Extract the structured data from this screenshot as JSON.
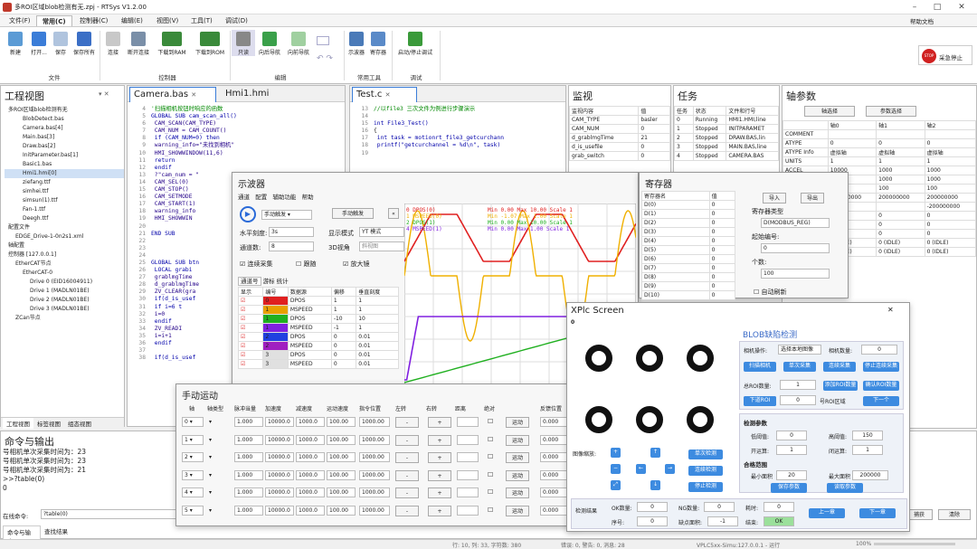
{
  "window": {
    "title": "多ROI区域blob检测有无.zpj - RTSys V1.2.00",
    "help_label": "帮助文档"
  },
  "menus": [
    "文件(F)",
    "常用(C)",
    "控制器(C)",
    "编辑(E)",
    "视图(V)",
    "工具(T)",
    "调试(D)"
  ],
  "ribbon": {
    "file": [
      "新建",
      "打开...",
      "保存",
      "保存所有"
    ],
    "controller": [
      "连接",
      "断开连接",
      "下载到RAM",
      "下载到ROM"
    ],
    "edit": [
      "只读",
      "向后导航",
      "向前导航"
    ],
    "tools": [
      "示波器",
      "寄存器"
    ],
    "debug": [
      "启动/停止调试"
    ],
    "groups": {
      "file": "文件",
      "controller": "控制器",
      "edit": "编辑",
      "tools": "常用工具",
      "debug": "调试"
    },
    "estop": "采急停止"
  },
  "project": {
    "title": "工程视图",
    "items": [
      "多ROI区域blob检测有无",
      "BlobDetect.bas",
      "Camera.bas[4]",
      "Main.bas[3]",
      "Draw.bas[2]",
      "InitParameter.bas[1]",
      "Basic1.bas",
      "Hmi1.hmi[0]",
      "ziefang.ttf",
      "simhei.ttf",
      "simsun(1).ttf",
      "Fan-1.ttf",
      "Deegh.ttf",
      "配置文件",
      "EDGE_Drive-1-0n2s1.xml",
      "轴配置",
      "控制器 [127.0.0.1]",
      "EtherCAT节点",
      "EtherCAT-0",
      "Drive 0 (EID16004911)",
      "Drive 1 (MADLN01BE)",
      "Drive 2 (MADLN01BE)",
      "Drive 3 (MADLN01BE)",
      "ZCan节点"
    ],
    "tabs": [
      "工程视图",
      "标签视图",
      "组态视图"
    ]
  },
  "editor_tabs": [
    "Camera.bas",
    "Hmi1.hmi",
    "Test.c"
  ],
  "camera_code": [
    [
      "4",
      "'扫描相机按钮时响应的函数"
    ],
    [
      "5",
      "GLOBAL SUB cam_scan_all()"
    ],
    [
      "6",
      "    CAM_SCAN(CAM_TYPE)"
    ],
    [
      "7",
      "    CAM_NUM = CAM_COUNT()"
    ],
    [
      "8",
      "    if (CAM_NUM=0) then"
    ],
    [
      "9",
      "        warning_info=\"未找到相机\""
    ],
    [
      "10",
      "        HMI_SHOWWINDOW(11,6)"
    ],
    [
      "11",
      "        return"
    ],
    [
      "12",
      "    endif"
    ],
    [
      "13",
      "    ?\"cam_num = \""
    ],
    [
      "14",
      "    CAM_SEL(0)"
    ],
    [
      "15",
      "    CAM_STOP()"
    ],
    [
      "16",
      "    CAM_SETMODE"
    ],
    [
      "17",
      "    CAM_START(1)"
    ],
    [
      "18",
      "    warning_info"
    ],
    [
      "19",
      "    HMI_SHOWWIN"
    ],
    [
      "20",
      ""
    ],
    [
      "21",
      "END SUB"
    ],
    [
      "22",
      ""
    ],
    [
      "23",
      ""
    ],
    [
      "24",
      ""
    ],
    [
      "25",
      "GLOBAL SUB btn"
    ],
    [
      "26",
      "    LOCAL grabi"
    ],
    [
      "27",
      "    grablmgTime"
    ],
    [
      "28",
      "    d_grablmgTime"
    ],
    [
      "29",
      "    ZV_CLEAR(gra"
    ],
    [
      "30",
      "    if(d_is_usef"
    ],
    [
      "31",
      "        if i=6 t"
    ],
    [
      "32",
      "            i=0"
    ],
    [
      "33",
      "        endif"
    ],
    [
      "34",
      "        ZV_READI"
    ],
    [
      "35",
      "        i=i+1"
    ],
    [
      "36",
      "    endif"
    ],
    [
      "37",
      ""
    ],
    [
      "38",
      "    if(d_is_usef"
    ]
  ],
  "test_code": [
    [
      "13",
      "//以file3 三次文件为例进行步骤演示"
    ],
    [
      "14",
      ""
    ],
    [
      "15",
      "int File3_Test()"
    ],
    [
      "16",
      "{"
    ],
    [
      "17",
      "    int task = motionrt_file3_getcurchann"
    ],
    [
      "18",
      "    printf(\"getcurchannel = %d\\n\", task)"
    ],
    [
      "19",
      ""
    ]
  ],
  "monitor": {
    "title": "监视",
    "cols": [
      "监视内容",
      "值"
    ],
    "rows": [
      [
        "CAM_TYPE",
        "basler"
      ],
      [
        "CAM_NUM",
        "0"
      ],
      [
        "d_grablmgTime",
        "21"
      ],
      [
        "d_is_usefile",
        "0"
      ],
      [
        "grab_switch",
        "0"
      ]
    ]
  },
  "task": {
    "title": "任务",
    "cols": [
      "任务",
      "状态",
      "文件和行号"
    ],
    "rows": [
      [
        "0",
        "Running",
        "HMI1.HMI,line"
      ],
      [
        "1",
        "Stopped",
        "INITPARAMET"
      ],
      [
        "2",
        "Stopped",
        "DRAW.BAS,lin"
      ],
      [
        "3",
        "Stopped",
        "MAIN.BAS,line"
      ],
      [
        "4",
        "Stopped",
        "CAMERA.BAS"
      ]
    ]
  },
  "axis": {
    "title": "轴参数",
    "btn1": "轴选择",
    "btn2": "参数选择",
    "cols": [
      "",
      "轴0",
      "轴1",
      "轴2"
    ],
    "rows": [
      [
        "COMMENT",
        "",
        "",
        ""
      ],
      [
        "ATYPE",
        "0",
        "0",
        "0"
      ],
      [
        "ATYPE Info",
        "虚拟轴",
        "虚拟轴",
        "虚拟轴"
      ],
      [
        "UNITS",
        "1",
        "1",
        "1"
      ],
      [
        "ACCEL",
        "10000",
        "1000",
        "1000"
      ],
      [
        "DECEL",
        "1000",
        "1000",
        "1000"
      ],
      [
        "SPEED",
        "100",
        "100",
        "100"
      ],
      [
        "",
        "200000000",
        "200000000",
        "200000000"
      ],
      [
        "",
        "",
        "",
        "-200000000"
      ],
      [
        "",
        "0",
        "0",
        "0"
      ],
      [
        "",
        "0",
        "0",
        "0"
      ],
      [
        "",
        "0",
        "0",
        "0"
      ],
      [
        "",
        "0 (IDLE)",
        "0 (IDLE)",
        "0 (IDLE)"
      ],
      [
        "",
        "0 (IDLE)",
        "0 (IDLE)",
        "0 (IDLE)"
      ]
    ]
  },
  "scope": {
    "title": "示波器",
    "menu": [
      "通道",
      "配置",
      "辅助功能",
      "帮助"
    ],
    "trigger": "手动触发",
    "trigger_btn": "手动触发",
    "hscale_label": "水平刻度:",
    "hscale": "3s",
    "mode_label": "显示模式",
    "mode": "YT 模式",
    "chcount_label": "通道数:",
    "chcount": "8",
    "view3d_label": "3D视角",
    "view3d": "斜视图",
    "continuous": "连续采集",
    "follow": "跟随",
    "zoom": "放大镜",
    "subtabs": [
      "通道号",
      "游标",
      "统计"
    ],
    "cols": [
      "显示",
      "编号",
      "数据源",
      "偏移",
      "垂直刻度"
    ],
    "rows": [
      [
        "0",
        "DPOS",
        "1",
        "1"
      ],
      [
        "1",
        "MSPEED",
        "1",
        "1"
      ],
      [
        "1",
        "DPOS",
        "-10",
        "10"
      ],
      [
        "1",
        "MSPEED",
        "-1",
        "1"
      ],
      [
        "2",
        "DPOS",
        "0",
        "0.01"
      ],
      [
        "2",
        "MSPEED",
        "0",
        "0.01"
      ],
      [
        "3",
        "DPOS",
        "0",
        "0.01"
      ],
      [
        "3",
        "MSPEED",
        "0",
        "0.01"
      ]
    ],
    "row_colors": [
      "#e02020",
      "#e8a000",
      "#20b020",
      "#8020e0",
      "#2040e0",
      "#a020c0",
      "#e0e0e0",
      "#e0e0e0"
    ],
    "legend": [
      "0 DPOS(0)",
      "1 MSPEED(0)",
      "2 DPOS(1)",
      "4 MSPEED(1)"
    ],
    "stats": [
      "Min 0.00  Max 10.00  Scale 1",
      "Min -1.07  Max 1.00  Scale 1",
      "Min 0.00  Max 10.00  Scale 1",
      "Min 0.00  Max 1.00  Scale 1"
    ]
  },
  "register": {
    "title": "寄存器",
    "cols": [
      "寄存器名",
      "值"
    ],
    "rows": [
      [
        "D(0)",
        "0"
      ],
      [
        "D(1)",
        "0"
      ],
      [
        "D(2)",
        "0"
      ],
      [
        "D(3)",
        "0"
      ],
      [
        "D(4)",
        "0"
      ],
      [
        "D(5)",
        "0"
      ],
      [
        "D(6)",
        "0"
      ],
      [
        "D(7)",
        "0"
      ],
      [
        "D(8)",
        "0"
      ],
      [
        "D(9)",
        "0"
      ],
      [
        "D(10)",
        "0"
      ]
    ],
    "import": "导入",
    "export": "导出",
    "type_label": "寄存器类型",
    "type": "D(MODBUS_REG)",
    "start_label": "起始编号:",
    "start": "0",
    "count_label": "个数:",
    "count": "100",
    "auto": "自动刷新"
  },
  "motion": {
    "title": "手动运动",
    "cols": [
      "轴",
      "轴类型",
      "脉冲当量",
      "加速度",
      "减速度",
      "运动速度",
      "指令位置",
      "左转",
      "右转",
      "距离",
      "绝对",
      "",
      "反馈位置"
    ],
    "rows": [
      [
        "0",
        "1.000",
        "10000.0",
        "1000.0",
        "100.00",
        "1000.00",
        "0.000"
      ],
      [
        "1",
        "1.000",
        "10000.0",
        "1000.0",
        "100.00",
        "1000.00",
        "0.000"
      ],
      [
        "2",
        "1.000",
        "10000.0",
        "1000.0",
        "100.00",
        "1000.00",
        "0.000"
      ],
      [
        "3",
        "1.000",
        "10000.0",
        "1000.0",
        "100.00",
        "1000.00",
        "0.000"
      ],
      [
        "4",
        "1.000",
        "10000.0",
        "1000.0",
        "100.00",
        "1000.00",
        "0.000"
      ],
      [
        "5",
        "1.000",
        "10000.0",
        "1000.0",
        "100.00",
        "1000.00",
        "0.000"
      ]
    ],
    "run": "运动",
    "minus": "-",
    "plus": "+"
  },
  "xplc": {
    "title": "XPlc Screen",
    "corner": "0",
    "header": "BLOB缺陷检测",
    "cam_op": "相机操作:",
    "cam_sel": "选择本地图像",
    "cam_num_label": "相机数量:",
    "cam_num": "0",
    "btns1": [
      "扫描相机",
      "单次采集",
      "连续采集",
      "停止连续采集"
    ],
    "roi_label": "总ROI数量:",
    "roi": "1",
    "roi_btns": [
      "添加ROI数量",
      "确认ROI数量"
    ],
    "roi_no_btn": "下道ROI",
    "roi_no": "0",
    "roi_area": "号ROI区域",
    "next": "下一个",
    "params": "检测参数",
    "low_label": "低阈值:",
    "low": "0",
    "high_label": "高阈值:",
    "high": "150",
    "open_label": "开运算:",
    "open": "1",
    "close_label": "闭运算:",
    "close": "1",
    "range": "合格范围",
    "min_area_label": "最小面积",
    "min_area": "20",
    "max_area_label": "最大面积",
    "max_area": "200000",
    "save": "保存参数",
    "read": "读取参数",
    "zoom": "图像缩放:",
    "single": "单次检测",
    "cont": "连续检测",
    "stop": "停止检测",
    "result": "检测结果",
    "ok_num_label": "OK数量:",
    "ok_num": "0",
    "ng_num_label": "NG数量:",
    "ng_num": "0",
    "time_label": "耗时:",
    "time": "0",
    "seq_label": "序号:",
    "seq": "0",
    "area_label": "缺点面积:",
    "area": "-1",
    "end_label": "结束:",
    "end": "OK",
    "prev": "上一章",
    "nextp": "下一章"
  },
  "cmd": {
    "title": "命令与输出",
    "lines": [
      "号相机单次采集时间为：23",
      "号相机单次采集时间为：23",
      "号相机单次采集时间为：21",
      ">>?table(0)",
      "0"
    ],
    "input_label": "在线命令:",
    "input": "?table(0)",
    "tabs": [
      "命令与输出",
      "查找结果"
    ],
    "clear": "清除",
    "other": "捕获"
  },
  "status": {
    "pos": "行: 10, 列: 33, 字符数: 380",
    "err": "错误: 0, 警告: 0, 消息: 28",
    "sim": "VPLC5xx-Simu:127.0.0.1 - 运行",
    "zoom": "100%"
  },
  "colors": {
    "accent": "#1a6fd1",
    "estop": "#d02020"
  }
}
